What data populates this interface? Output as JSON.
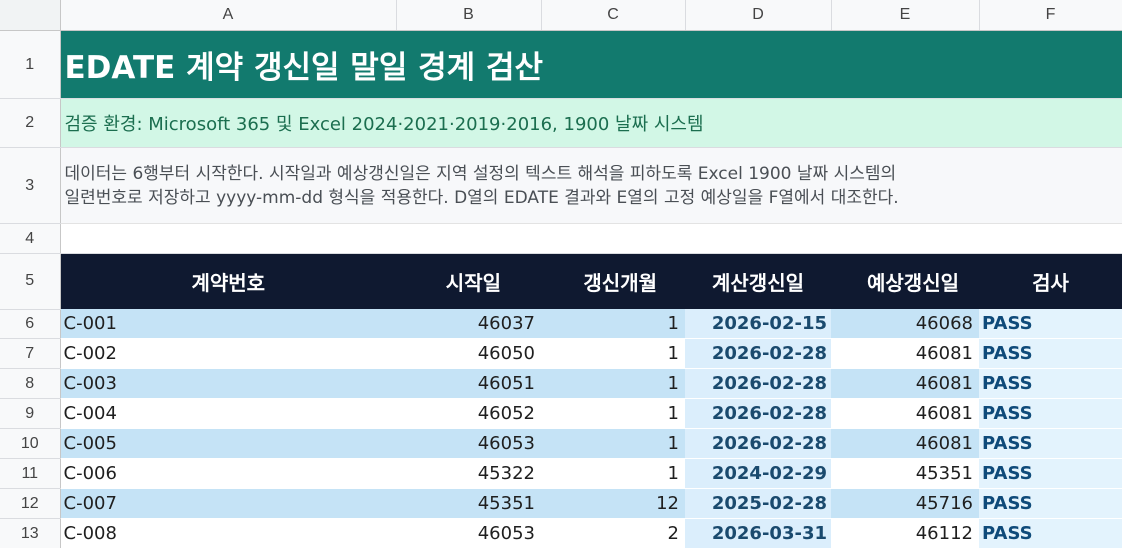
{
  "columns": [
    "A",
    "B",
    "C",
    "D",
    "E",
    "F"
  ],
  "row_numbers": [
    "1",
    "2",
    "3",
    "4",
    "5",
    "6",
    "7",
    "8",
    "9",
    "10",
    "11",
    "12",
    "13"
  ],
  "title": "EDATE 계약 갱신일 말일 경계 검산",
  "environment": "검증 환경: Microsoft 365 및 Excel 2024·2021·2019·2016, 1900 날짜 시스템",
  "note_line1": "데이터는 6행부터 시작한다. 시작일과 예상갱신일은 지역 설정의 텍스트 해석을 피하도록 Excel 1900 날짜 시스템의",
  "note_line2": "일련번호로 저장하고 yyyy-mm-dd 형식을 적용한다. D열의 EDATE 결과와 E열의 고정 예상일을 F열에서 대조한다.",
  "headers": [
    "계약번호",
    "시작일",
    "갱신개월",
    "계산갱신일",
    "예상갱신일",
    "검사"
  ],
  "rows": [
    {
      "contract": "C-001",
      "start": "46037",
      "months": "1",
      "calc": "2026-02-15",
      "expected": "46068",
      "check": "PASS"
    },
    {
      "contract": "C-002",
      "start": "46050",
      "months": "1",
      "calc": "2026-02-28",
      "expected": "46081",
      "check": "PASS"
    },
    {
      "contract": "C-003",
      "start": "46051",
      "months": "1",
      "calc": "2026-02-28",
      "expected": "46081",
      "check": "PASS"
    },
    {
      "contract": "C-004",
      "start": "46052",
      "months": "1",
      "calc": "2026-02-28",
      "expected": "46081",
      "check": "PASS"
    },
    {
      "contract": "C-005",
      "start": "46053",
      "months": "1",
      "calc": "2026-02-28",
      "expected": "46081",
      "check": "PASS"
    },
    {
      "contract": "C-006",
      "start": "45322",
      "months": "1",
      "calc": "2024-02-29",
      "expected": "45351",
      "check": "PASS"
    },
    {
      "contract": "C-007",
      "start": "45351",
      "months": "12",
      "calc": "2025-02-28",
      "expected": "45716",
      "check": "PASS"
    },
    {
      "contract": "C-008",
      "start": "46053",
      "months": "2",
      "calc": "2026-03-31",
      "expected": "46112",
      "check": "PASS"
    }
  ],
  "colors": {
    "title_bg": "#127a6e",
    "env_bg": "#d2f7e6",
    "header_band_bg": "#0f1930",
    "band_blue": "#c5e3f6",
    "calc_text": "#1a4a6e",
    "pass_text": "#0e4a7a"
  }
}
